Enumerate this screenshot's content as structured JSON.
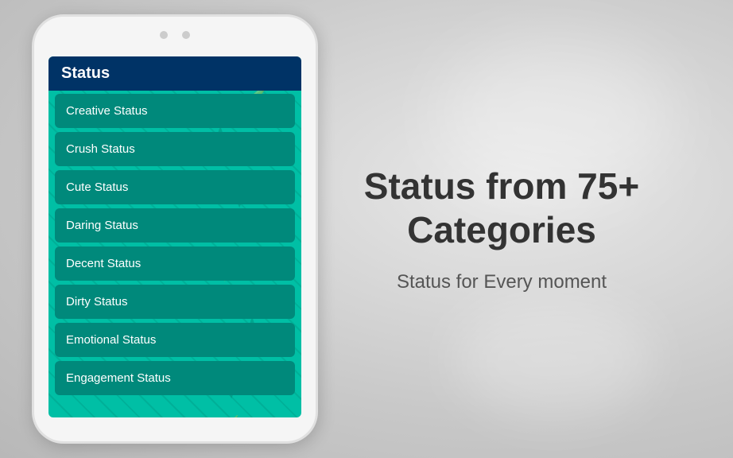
{
  "app": {
    "header": {
      "title": "Status"
    },
    "menu_items": [
      {
        "label": "Creative Status"
      },
      {
        "label": "Crush Status"
      },
      {
        "label": "Cute Status"
      },
      {
        "label": "Daring Status"
      },
      {
        "label": "Decent Status"
      },
      {
        "label": "Dirty Status"
      },
      {
        "label": "Emotional Status"
      },
      {
        "label": "Engagement Status"
      }
    ]
  },
  "right": {
    "main_heading": "Status from 75+ Categories",
    "sub_heading": "Status for Every moment"
  },
  "phone": {
    "dot1": "●",
    "dot2": "●"
  }
}
